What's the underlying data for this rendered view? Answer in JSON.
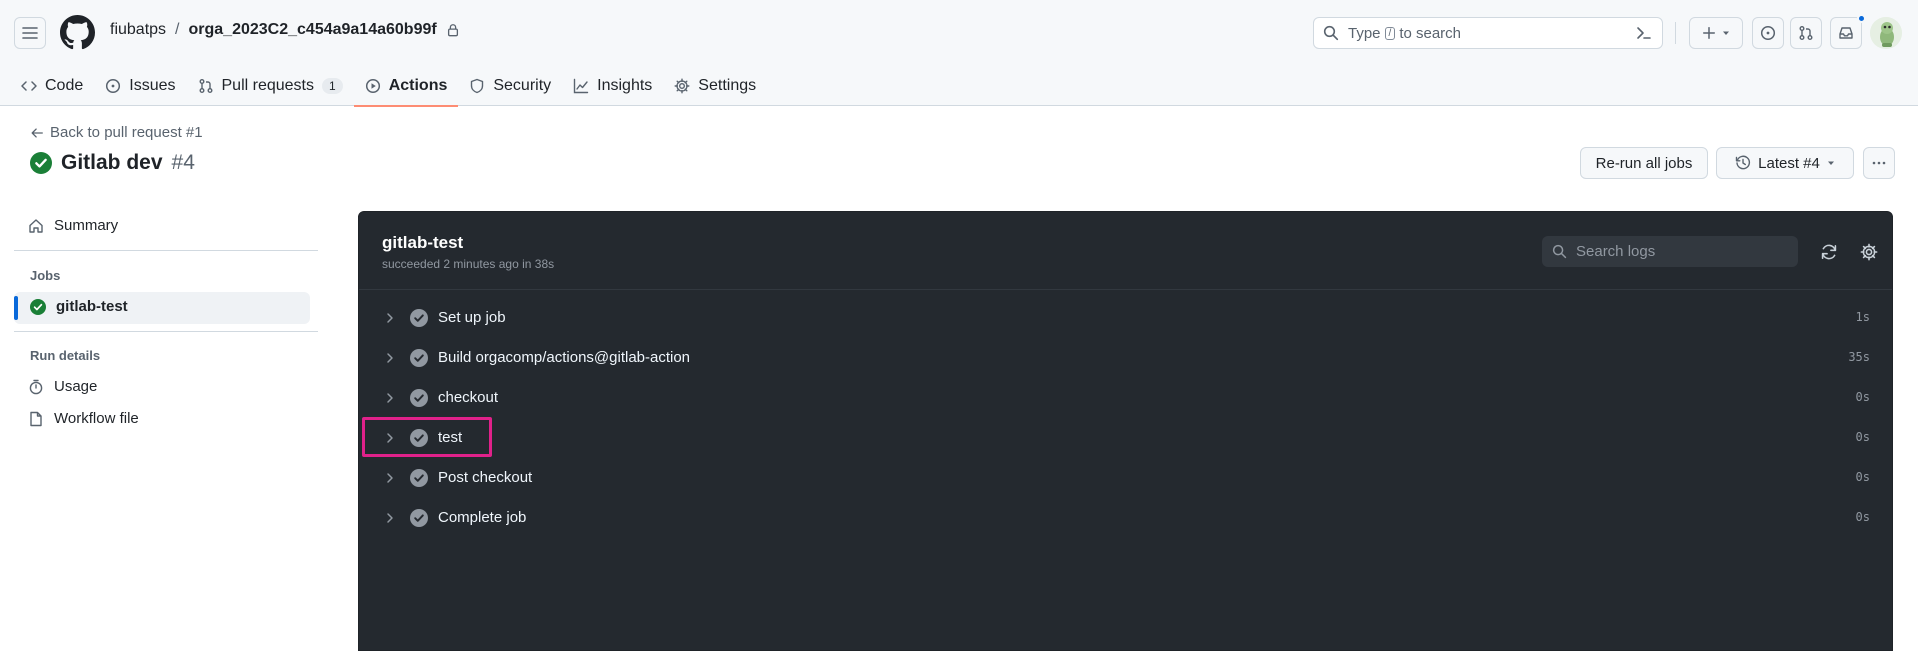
{
  "header": {
    "owner": "fiubatps",
    "separator": "/",
    "repo": "orga_2023C2_c454a9a14a60b99f",
    "search": {
      "prefix": "Type",
      "key": "/",
      "suffix": "to search"
    }
  },
  "tabs": [
    {
      "label": "Code",
      "icon": "code-icon"
    },
    {
      "label": "Issues",
      "icon": "issue-opened-icon"
    },
    {
      "label": "Pull requests",
      "icon": "git-pull-request-icon",
      "counter": "1"
    },
    {
      "label": "Actions",
      "icon": "play-icon",
      "active": true
    },
    {
      "label": "Security",
      "icon": "shield-icon"
    },
    {
      "label": "Insights",
      "icon": "graph-icon"
    },
    {
      "label": "Settings",
      "icon": "gear-icon"
    }
  ],
  "run": {
    "back_label": "Back to pull request #1",
    "title": "Gitlab dev",
    "number": "#4",
    "rerun_label": "Re-run all jobs",
    "latest_label": "Latest #4"
  },
  "sidebar": {
    "summary": "Summary",
    "jobs_heading": "Jobs",
    "job": "gitlab-test",
    "run_details_heading": "Run details",
    "usage": "Usage",
    "workflow_file": "Workflow file"
  },
  "job_panel": {
    "title": "gitlab-test",
    "subtitle": "succeeded 2 minutes ago in 38s",
    "search_placeholder": "Search logs",
    "steps": [
      {
        "label": "Set up job",
        "duration": "1s"
      },
      {
        "label": "Build orgacomp/actions@gitlab-action",
        "duration": "35s"
      },
      {
        "label": "checkout",
        "duration": "0s"
      },
      {
        "label": "test",
        "duration": "0s"
      },
      {
        "label": "Post checkout",
        "duration": "0s"
      },
      {
        "label": "Complete job",
        "duration": "0s"
      }
    ]
  },
  "colors": {
    "accent_tab_underline": "#fd8c73",
    "success": "#1a7f37",
    "panel_bg": "#24292f",
    "highlight_box": "#e0218a",
    "link_blue": "#0969da"
  }
}
